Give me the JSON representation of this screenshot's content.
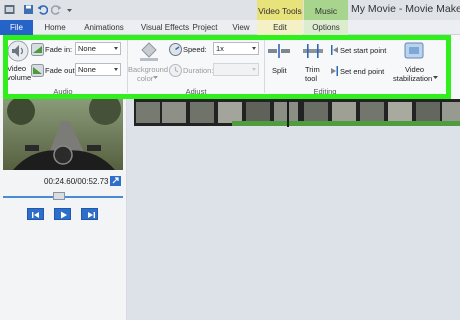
{
  "titlebar": {
    "title": "My Movie - Movie Maker",
    "context_video": "Video Tools",
    "context_music": "Music Tools"
  },
  "tabs": {
    "file": "File",
    "home": "Home",
    "animations": "Animations",
    "visual_effects": "Visual Effects",
    "project": "Project",
    "view": "View",
    "edit": "Edit",
    "options": "Options"
  },
  "ribbon": {
    "audio": {
      "group_label": "Audio",
      "video_volume_line1": "Video",
      "video_volume_line2": "volume",
      "fade_in_label": "Fade in:",
      "fade_in_value": "None",
      "fade_out_label": "Fade out:",
      "fade_out_value": "None"
    },
    "adjust": {
      "group_label": "Adjust",
      "background_color_line1": "Background",
      "background_color_line2": "color",
      "speed_label": "Speed:",
      "speed_value": "1x",
      "duration_label": "Duration:"
    },
    "editing": {
      "group_label": "Editing",
      "split": "Split",
      "trim_line1": "Trim",
      "trim_line2": "tool",
      "set_start": "Set start point",
      "set_end": "Set end point",
      "stabilization_line1": "Video",
      "stabilization_line2": "stabilization"
    }
  },
  "preview": {
    "time": "00:24.60/00:52.73",
    "seek_fraction": 0.47
  },
  "colors": {
    "highlight": "#2ff01d",
    "file_tab": "#2563c9",
    "video_tools": "#e8e27a",
    "music_tools": "#a7d58d"
  }
}
